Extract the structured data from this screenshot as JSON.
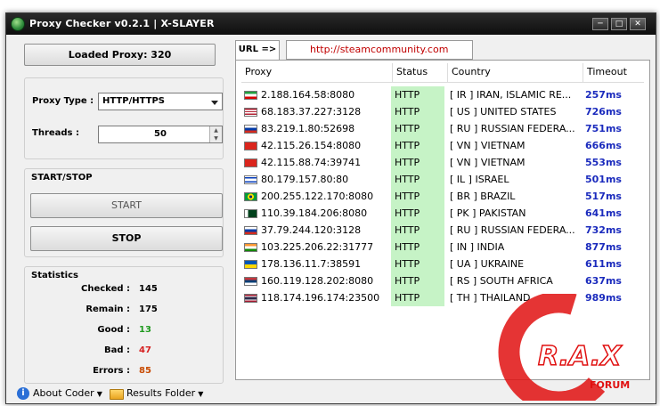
{
  "window": {
    "title": "Proxy Checker v0.2.1 | X-SLAYER",
    "controls": {
      "minimize": "─",
      "maximize": "□",
      "close": "✕"
    }
  },
  "left": {
    "loaded_proxy_label": "Loaded Proxy: 320",
    "proxy_type_label": "Proxy Type :",
    "proxy_type_value": "HTTP/HTTPS",
    "threads_label": "Threads :",
    "threads_value": "50",
    "start_stop_title": "START/STOP",
    "start_label": "START",
    "stop_label": "STOP",
    "statistics_title": "Statistics",
    "stats": [
      {
        "label": "Checked :",
        "value": "145",
        "color": "#000000"
      },
      {
        "label": "Remain :",
        "value": "175",
        "color": "#000000"
      },
      {
        "label": "Good :",
        "value": "13",
        "color": "#1f9a1f"
      },
      {
        "label": "Bad :",
        "value": "47",
        "color": "#d62020"
      },
      {
        "label": "Errors :",
        "value": "85",
        "color": "#c84a00"
      }
    ]
  },
  "url": {
    "tab_label": "URL =>",
    "value": "http://steamcommunity.com"
  },
  "table": {
    "columns": [
      "Proxy",
      "Status",
      "Country",
      "Timeout"
    ],
    "rows": [
      {
        "proxy": "2.188.164.58:8080",
        "status": "HTTP",
        "country": "[ IR ] IRAN, ISLAMIC RE...",
        "timeout": "257ms",
        "flag": "flag-ir-icon"
      },
      {
        "proxy": "68.183.37.227:3128",
        "status": "HTTP",
        "country": "[ US ] UNITED STATES",
        "timeout": "726ms",
        "flag": "flag-us-icon"
      },
      {
        "proxy": "83.219.1.80:52698",
        "status": "HTTP",
        "country": "[ RU ] RUSSIAN FEDERA...",
        "timeout": "751ms",
        "flag": "flag-ru-icon"
      },
      {
        "proxy": "42.115.26.154:8080",
        "status": "HTTP",
        "country": "[ VN ] VIETNAM",
        "timeout": "666ms",
        "flag": "flag-vn-icon"
      },
      {
        "proxy": "42.115.88.74:39741",
        "status": "HTTP",
        "country": "[ VN ] VIETNAM",
        "timeout": "553ms",
        "flag": "flag-vn-icon"
      },
      {
        "proxy": "80.179.157.80:80",
        "status": "HTTP",
        "country": "[ IL ] ISRAEL",
        "timeout": "501ms",
        "flag": "flag-il-icon"
      },
      {
        "proxy": "200.255.122.170:8080",
        "status": "HTTP",
        "country": "[ BR ] BRAZIL",
        "timeout": "517ms",
        "flag": "flag-br-icon"
      },
      {
        "proxy": "110.39.184.206:8080",
        "status": "HTTP",
        "country": "[ PK ] PAKISTAN",
        "timeout": "641ms",
        "flag": "flag-pk-icon"
      },
      {
        "proxy": "37.79.244.120:3128",
        "status": "HTTP",
        "country": "[ RU ] RUSSIAN FEDERA...",
        "timeout": "732ms",
        "flag": "flag-ru-icon"
      },
      {
        "proxy": "103.225.206.22:31777",
        "status": "HTTP",
        "country": "[ IN ] INDIA",
        "timeout": "877ms",
        "flag": "flag-in-icon"
      },
      {
        "proxy": "178.136.11.7:38591",
        "status": "HTTP",
        "country": "[ UA ] UKRAINE",
        "timeout": "611ms",
        "flag": "flag-ua-icon"
      },
      {
        "proxy": "160.119.128.202:8080",
        "status": "HTTP",
        "country": "[ RS ] SOUTH AFRICA",
        "timeout": "637ms",
        "flag": "flag-rs-icon"
      },
      {
        "proxy": "118.174.196.174:23500",
        "status": "HTTP",
        "country": "[ TH ] THAILAND",
        "timeout": "989ms",
        "flag": "flag-th-icon"
      }
    ]
  },
  "statusbar": {
    "about_label": "About Coder",
    "results_label": "Results Folder"
  },
  "watermark": {
    "brand": "R.A.X",
    "sub": "FORUM"
  }
}
